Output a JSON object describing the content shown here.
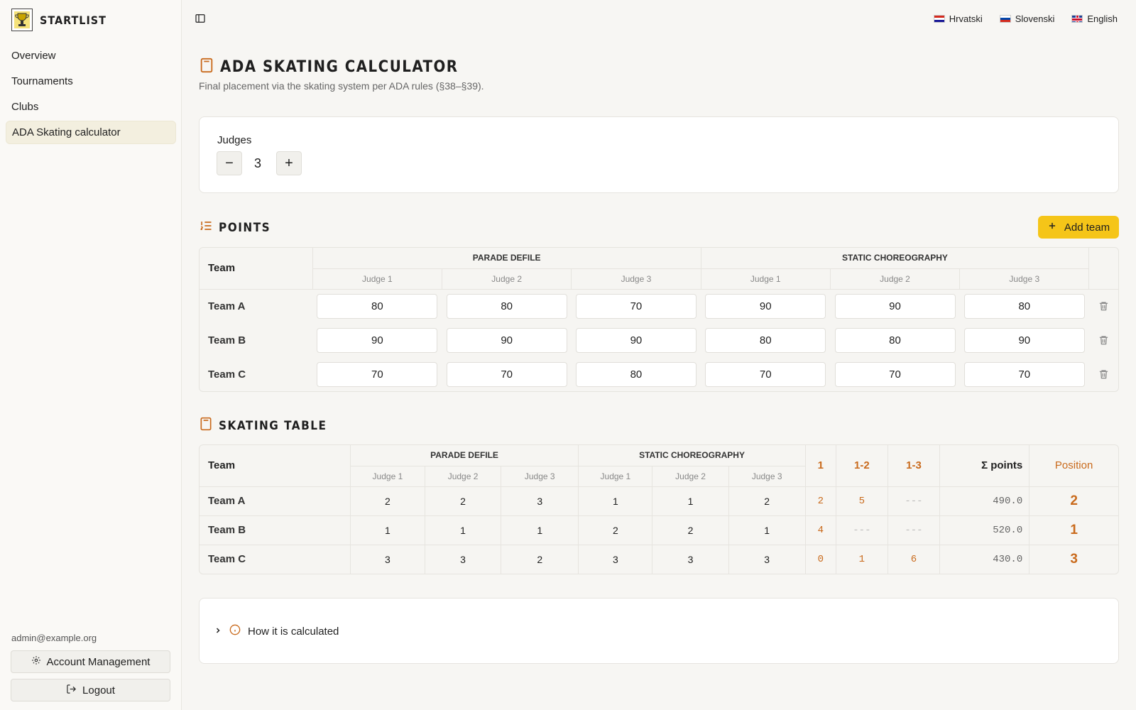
{
  "brand": {
    "name": "STARTLIST"
  },
  "sidebar": {
    "items": [
      {
        "label": "Overview"
      },
      {
        "label": "Tournaments"
      },
      {
        "label": "Clubs"
      },
      {
        "label": "ADA Skating calculator"
      }
    ],
    "user_email": "admin@example.org",
    "account_label": "Account Management",
    "logout_label": "Logout"
  },
  "languages": [
    {
      "label": "Hrvatski"
    },
    {
      "label": "Slovenski"
    },
    {
      "label": "English"
    }
  ],
  "page": {
    "title": "ADA SKATING CALCULATOR",
    "subtitle": "Final placement via the skating system per ADA rules (§38–§39)."
  },
  "judges": {
    "label": "Judges",
    "count": "3",
    "minus": "−",
    "plus": "+"
  },
  "points_section": {
    "title": "POINTS",
    "add_team_label": "Add team",
    "team_header": "Team",
    "groups": [
      "PARADE DEFILE",
      "STATIC CHOREOGRAPHY"
    ],
    "judge_labels": [
      "Judge 1",
      "Judge 2",
      "Judge 3",
      "Judge 1",
      "Judge 2",
      "Judge 3"
    ],
    "rows": [
      {
        "team": "Team A",
        "values": [
          "80",
          "80",
          "70",
          "90",
          "90",
          "80"
        ]
      },
      {
        "team": "Team B",
        "values": [
          "90",
          "90",
          "90",
          "80",
          "80",
          "90"
        ]
      },
      {
        "team": "Team C",
        "values": [
          "70",
          "70",
          "80",
          "70",
          "70",
          "70"
        ]
      }
    ]
  },
  "skating_section": {
    "title": "SKATING TABLE",
    "team_header": "Team",
    "groups": [
      "PARADE DEFILE",
      "STATIC CHOREOGRAPHY"
    ],
    "judge_labels": [
      "Judge 1",
      "Judge 2",
      "Judge 3",
      "Judge 1",
      "Judge 2",
      "Judge 3"
    ],
    "majority_headers": [
      "1",
      "1-2",
      "1-3"
    ],
    "sum_header": "Σ points",
    "position_header": "Position",
    "rows": [
      {
        "team": "Team A",
        "places": [
          "2",
          "2",
          "3",
          "1",
          "1",
          "2"
        ],
        "m1": "2",
        "m12": "5",
        "m13": "---",
        "sum": "490.0",
        "position": "2"
      },
      {
        "team": "Team B",
        "places": [
          "1",
          "1",
          "1",
          "2",
          "2",
          "1"
        ],
        "m1": "4",
        "m12": "---",
        "m13": "---",
        "sum": "520.0",
        "position": "1"
      },
      {
        "team": "Team C",
        "places": [
          "3",
          "3",
          "2",
          "3",
          "3",
          "3"
        ],
        "m1": "0",
        "m12": "1",
        "m13": "6",
        "sum": "430.0",
        "position": "3"
      }
    ]
  },
  "how": {
    "label": "How it is calculated"
  },
  "colors": {
    "accent": "#f5c518",
    "highlight": "#c96a1c"
  }
}
